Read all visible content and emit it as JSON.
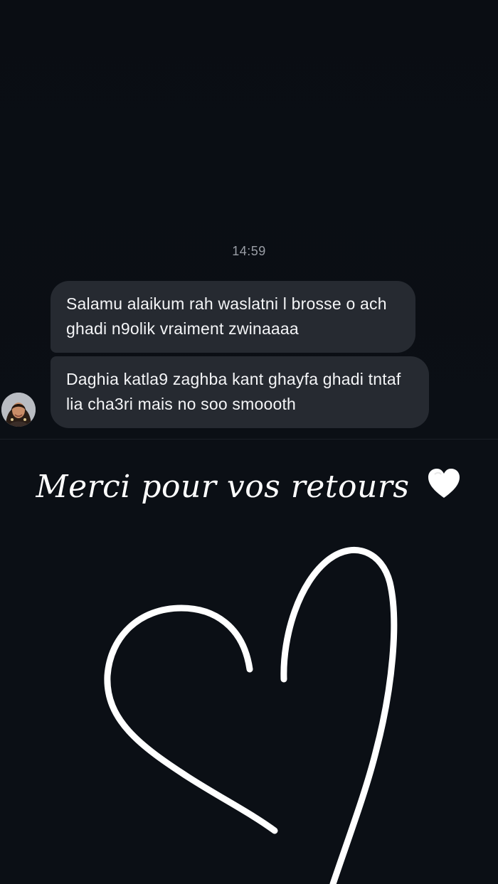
{
  "chat": {
    "timestamp": "14:59",
    "messages": [
      {
        "text": "Salamu alaikum rah waslatni l brosse o ach ghadi n9olik vraiment zwinaaaa"
      },
      {
        "text": "Daghia katla9 zaghba kant ghayfa ghadi tntaf lia cha3ri mais no soo smoooth"
      }
    ],
    "avatar_icon": "profile-photo"
  },
  "story": {
    "caption": "Merci pour vos retours",
    "caption_icon": "white-heart-emoji",
    "drawing_icon": "hand-drawn-heart"
  },
  "colors": {
    "background": "#0b0f15",
    "bubble": "#262a31",
    "text": "#f4f5f7",
    "timestamp": "#9a9ea6"
  }
}
